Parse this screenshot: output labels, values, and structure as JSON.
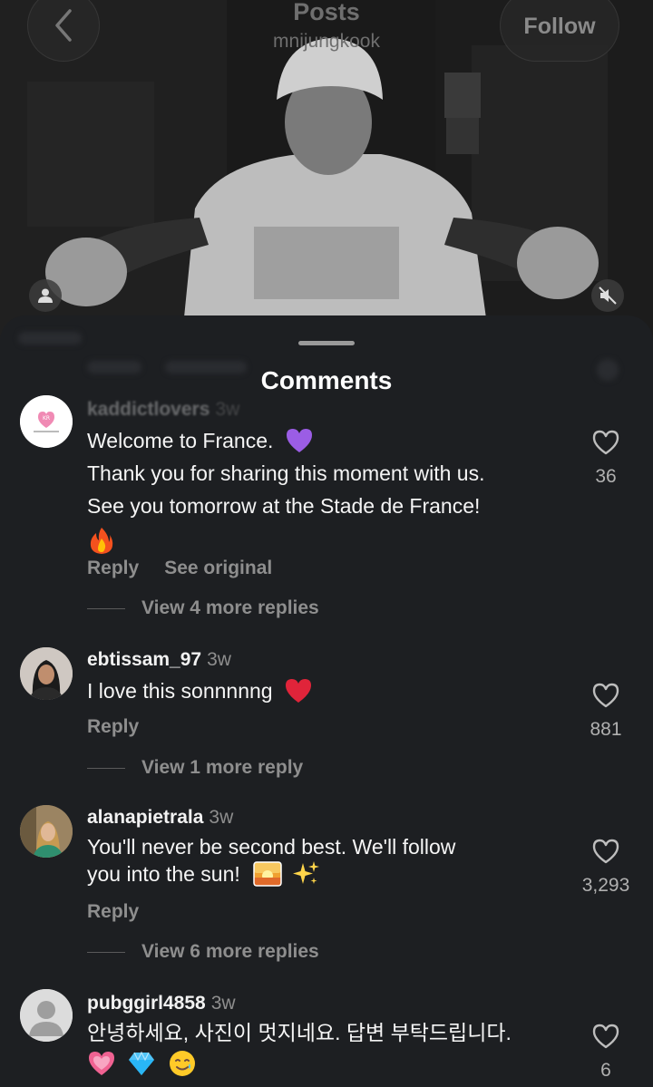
{
  "header": {
    "title": "Posts",
    "username": "mnijungkook",
    "follow_label": "Follow"
  },
  "sheet": {
    "title": "Comments"
  },
  "comments": [
    {
      "username": "kaddictlovers",
      "time": "3w",
      "lines": [
        "Welcome to France.",
        "Thank you for sharing this moment with us.",
        "See you tomorrow at the Stade de France!"
      ],
      "emojis": [
        "purple-heart",
        "fire"
      ],
      "actions": [
        "Reply",
        "See original"
      ],
      "view_more": "View 4 more replies",
      "likes": "36"
    },
    {
      "username": "ebtissam_97",
      "time": "3w",
      "lines": [
        "I love this sonnnnng"
      ],
      "emojis": [
        "red-heart"
      ],
      "actions": [
        "Reply"
      ],
      "view_more": "View 1 more reply",
      "likes": "881"
    },
    {
      "username": "alanapietrala",
      "time": "3w",
      "lines": [
        "You'll never be second best. We'll follow",
        "you into the sun!"
      ],
      "emojis": [
        "sunrise",
        "sparkles"
      ],
      "actions": [
        "Reply"
      ],
      "view_more": "View 6 more replies",
      "likes": "3,293"
    },
    {
      "username": "pubggirl4858",
      "time": "3w",
      "lines": [
        "안녕하세요, 사진이 멋지네요. 답변 부탁드립니다."
      ],
      "emojis": [
        "growing-heart",
        "gem",
        "smiling-face-with-tear"
      ],
      "likes": "6"
    }
  ],
  "colors": {
    "sheet_bg": "#1d1f22",
    "muted_text": "#8e8e8e",
    "purple_heart": "#9b5de5",
    "red_heart": "#e0243a"
  }
}
